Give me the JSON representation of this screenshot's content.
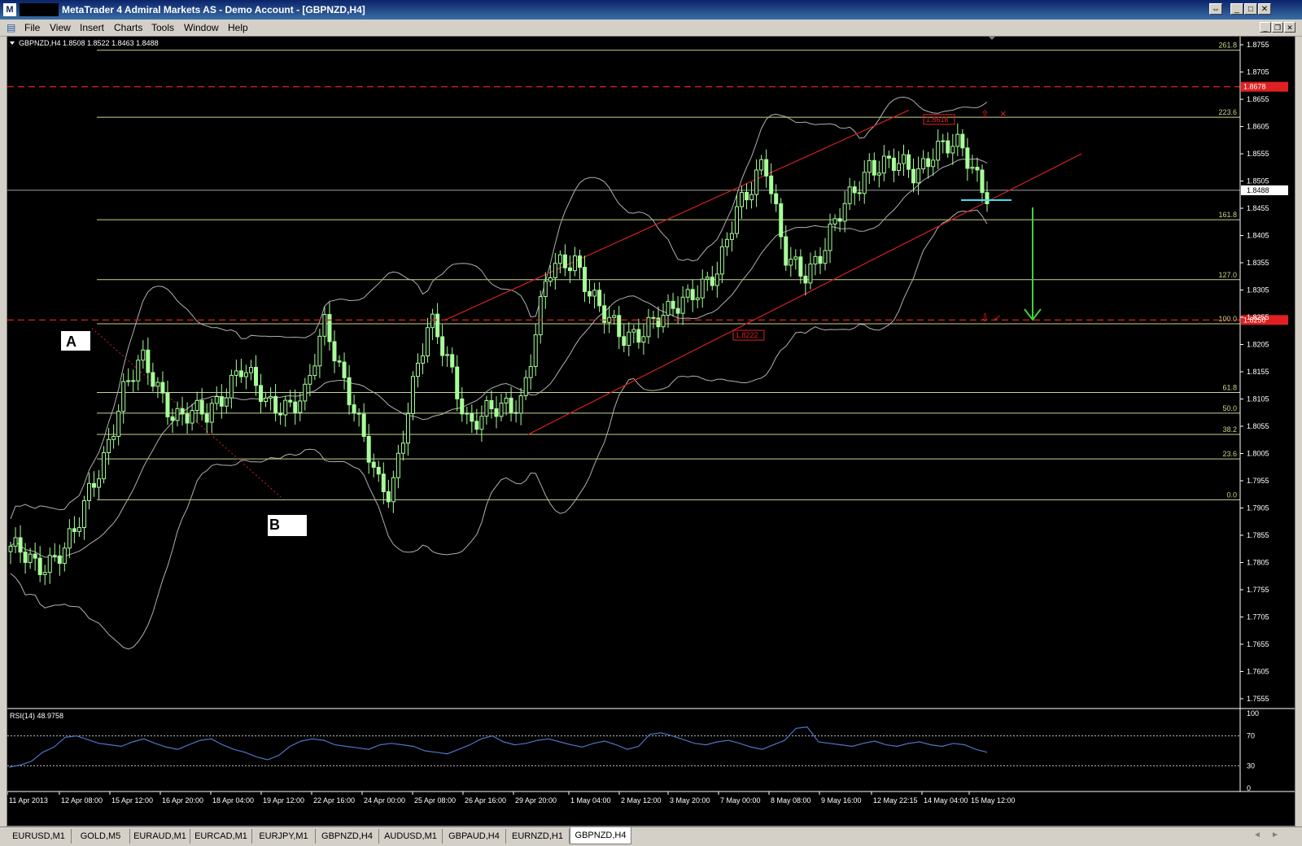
{
  "window": {
    "title": "MetaTrader 4 Admiral Markets AS - Demo Account - [GBPNZD,H4]"
  },
  "menu": [
    "File",
    "View",
    "Insert",
    "Charts",
    "Tools",
    "Window",
    "Help"
  ],
  "chart": {
    "header": "GBPNZD,H4  1.8508 1.8522 1.8463 1.8488",
    "price_scale": [
      "1.8755",
      "1.8705",
      "1.8655",
      "1.8605",
      "1.8555",
      "1.8505",
      "1.8455",
      "1.8405",
      "1.8355",
      "1.8305",
      "1.8255",
      "1.8205",
      "1.8155",
      "1.8105",
      "1.8055",
      "1.8005",
      "1.7955",
      "1.7905",
      "1.7855",
      "1.7805",
      "1.7755",
      "1.7705",
      "1.7655",
      "1.7605",
      "1.7555"
    ],
    "current_price": "1.8488",
    "red_level_upper": "1.8678",
    "red_level_lower": "1.8250",
    "fibo_levels": [
      "261.8",
      "223.6",
      "161.8",
      "127.0",
      "100.0",
      "61.8",
      "50.0",
      "38.2",
      "23.6",
      "0.0"
    ],
    "fibo_prices": [
      1.8745,
      1.8622,
      1.8434,
      1.8324,
      1.8243,
      1.8117,
      1.8079,
      1.804,
      1.7995,
      1.792
    ],
    "label_a": "A",
    "label_b": "B",
    "annotation_high": "1.8618",
    "annotation_low": "1.8222",
    "time_axis": [
      "11 Apr 2013",
      "12 Apr 08:00",
      "15 Apr 12:00",
      "16 Apr 20:00",
      "18 Apr 04:00",
      "19 Apr 12:00",
      "22 Apr 16:00",
      "24 Apr 00:00",
      "25 Apr 08:00",
      "26 Apr 16:00",
      "29 Apr 20:00",
      "1 May 04:00",
      "2 May 12:00",
      "3 May 20:00",
      "7 May 00:00",
      "8 May 08:00",
      "9 May 16:00",
      "12 May 22:15",
      "14 May 04:00",
      "15 May 12:00"
    ],
    "colors": {
      "background": "#000000",
      "candle": "#a8ff9a",
      "bands": "#b0b0b0",
      "fibo": "#c8d68a",
      "channel": "#d02020",
      "red_dash": "#e02020",
      "support": "#40e0f0",
      "arrow": "#40d040",
      "rsi_line": "#4f74c8"
    }
  },
  "rsi": {
    "header": "RSI(14) 48.9758",
    "scale": [
      "100",
      "70",
      "30",
      "0"
    ],
    "values": [
      28,
      31,
      36,
      48,
      55,
      68,
      70,
      65,
      60,
      58,
      56,
      62,
      66,
      60,
      55,
      52,
      58,
      64,
      66,
      58,
      52,
      48,
      42,
      38,
      44,
      56,
      63,
      66,
      64,
      58,
      56,
      54,
      52,
      58,
      60,
      58,
      56,
      50,
      48,
      46,
      52,
      58,
      66,
      70,
      62,
      58,
      60,
      64,
      66,
      62,
      58,
      55,
      60,
      63,
      58,
      52,
      56,
      72,
      74,
      70,
      65,
      60,
      58,
      62,
      64,
      60,
      55,
      52,
      58,
      64,
      80,
      82,
      62,
      60,
      58,
      56,
      60,
      63,
      58,
      56,
      60,
      62,
      58,
      56,
      60,
      58,
      52,
      48
    ]
  },
  "tabs": [
    "EURUSD,M1",
    "GOLD,M5",
    "EURAUD,M1",
    "EURCAD,M1",
    "EURJPY,M1",
    "GBPNZD,H4",
    "AUDUSD,M1",
    "GBPAUD,H4",
    "EURNZD,H1",
    "GBPNZD,H4"
  ],
  "active_tab_index": 9
}
